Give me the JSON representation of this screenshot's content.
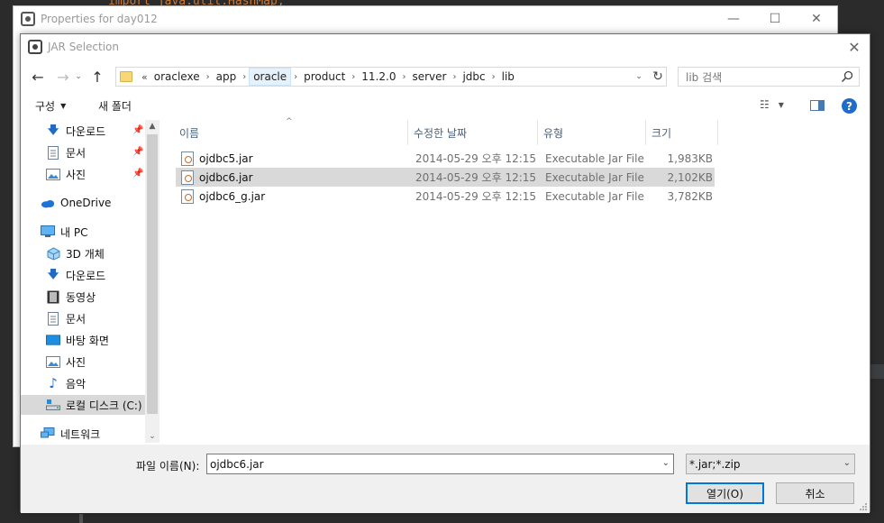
{
  "ide": {
    "code_fragment": "import java.util.HashMap;"
  },
  "properties_window": {
    "title": "Properties for day012",
    "buttons": {
      "minimize": "—",
      "maximize": "☐",
      "close": "✕"
    }
  },
  "dialog": {
    "title": "JAR Selection",
    "close": "✕"
  },
  "nav": {
    "back": "←",
    "forward": "→",
    "recent": "⌄",
    "up": "↑",
    "breadcrumb": [
      "oraclexe",
      "app",
      "oracle",
      "product",
      "11.2.0",
      "server",
      "jdbc",
      "lib"
    ],
    "breadcrumb_highlight_index": 2,
    "breadcrumb_overflow": "«",
    "search_placeholder": "lib 검색"
  },
  "toolbar": {
    "organize": "구성",
    "new_folder": "새 폴더"
  },
  "nav_pane": {
    "items": [
      {
        "label": "다운로드",
        "icon": "download-icon",
        "pinned": true
      },
      {
        "label": "문서",
        "icon": "document-icon",
        "pinned": true
      },
      {
        "label": "사진",
        "icon": "pictures-icon",
        "pinned": true
      },
      {
        "label": "OneDrive",
        "icon": "onedrive-icon",
        "pinned": false
      },
      {
        "label": "내 PC",
        "icon": "pc-icon",
        "pinned": false
      },
      {
        "label": "3D 개체",
        "icon": "3d-objects-icon",
        "pinned": false
      },
      {
        "label": "다운로드",
        "icon": "download-icon",
        "pinned": false
      },
      {
        "label": "동영상",
        "icon": "video-icon",
        "pinned": false
      },
      {
        "label": "문서",
        "icon": "document-icon",
        "pinned": false
      },
      {
        "label": "바탕 화면",
        "icon": "desktop-icon",
        "pinned": false
      },
      {
        "label": "사진",
        "icon": "pictures-icon",
        "pinned": false
      },
      {
        "label": "음악",
        "icon": "music-icon",
        "pinned": false
      },
      {
        "label": "로컬 디스크 (C:)",
        "icon": "local-disk-icon",
        "pinned": false,
        "selected": true
      },
      {
        "label": "네트워크",
        "icon": "network-icon",
        "pinned": false
      }
    ]
  },
  "file_list": {
    "columns": [
      "이름",
      "수정한 날짜",
      "유형",
      "크기"
    ],
    "rows": [
      {
        "name": "ojdbc5.jar",
        "date": "2014-05-29 오후 12:15",
        "type": "Executable Jar File",
        "size": "1,983KB",
        "selected": false
      },
      {
        "name": "ojdbc6.jar",
        "date": "2014-05-29 오후 12:15",
        "type": "Executable Jar File",
        "size": "2,102KB",
        "selected": true
      },
      {
        "name": "ojdbc6_g.jar",
        "date": "2014-05-29 오후 12:15",
        "type": "Executable Jar File",
        "size": "3,782KB",
        "selected": false
      }
    ]
  },
  "bottom": {
    "file_name_label": "파일 이름(N):",
    "file_name_value": "ojdbc6.jar",
    "file_type_value": "*.jar;*.zip",
    "open_button": "열기(O)",
    "cancel_button": "취소"
  }
}
